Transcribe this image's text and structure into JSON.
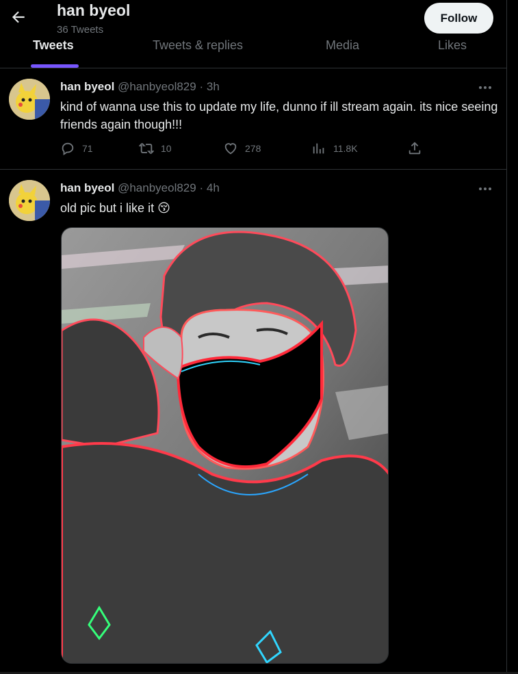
{
  "header": {
    "title": "han byeol",
    "subtitle": "36 Tweets",
    "follow_label": "Follow",
    "tabs": [
      {
        "label": "Tweets",
        "active": true
      },
      {
        "label": "Tweets & replies",
        "active": false
      },
      {
        "label": "Media",
        "active": false
      },
      {
        "label": "Likes",
        "active": false
      }
    ]
  },
  "tweets": [
    {
      "name": "han byeol",
      "handle": "@hanbyeol829",
      "dot": "·",
      "time": "3h",
      "text": "kind of wanna use this to update my life, dunno if ill stream again. its nice seeing friends again though!!!",
      "replies": "71",
      "retweets": "10",
      "likes": "278",
      "views": "11.8K"
    },
    {
      "name": "han byeol",
      "handle": "@hanbyeol829",
      "dot": "·",
      "time": "4h",
      "text": "old pic but i like it 😚",
      "has_media": true
    }
  ],
  "colors": {
    "background": "#000000",
    "text_primary": "#e7e9ea",
    "text_secondary": "#71767b",
    "follow_bg": "#eff3f4",
    "tab_indicator": "#7856ff",
    "divider": "#2f3336"
  },
  "icons": [
    "back-arrow-icon",
    "more-icon",
    "reply-icon",
    "retweet-icon",
    "like-icon",
    "views-icon",
    "share-icon"
  ]
}
